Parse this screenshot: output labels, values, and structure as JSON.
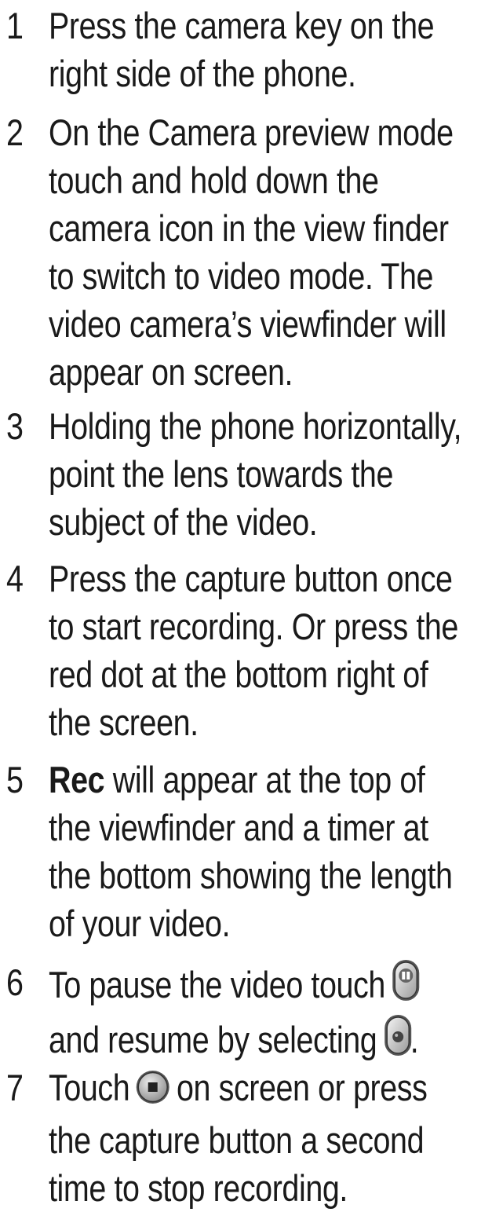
{
  "steps": [
    {
      "number": "1",
      "lines": [
        "Press the camera key on the",
        "right side of the phone."
      ]
    },
    {
      "number": "2",
      "lines": [
        "On the Camera preview mode",
        "touch and hold down the",
        "camera icon in the view finder",
        "to switch to video mode. The",
        "video camera’s viewfinder will",
        "appear on screen."
      ]
    },
    {
      "number": "3",
      "lines": [
        "Holding the phone horizontally,",
        "point the lens towards the",
        "subject of the video."
      ]
    },
    {
      "number": "4",
      "lines": [
        "Press the capture button once",
        "to start recording. Or press the",
        "red dot at the bottom right of",
        "the screen."
      ]
    },
    {
      "number": "5",
      "rec_label": "Rec",
      "line1_rest": " will appear at the top of",
      "lines": [
        "the viewfinder and a timer at",
        "the bottom showing the length",
        "of your video."
      ]
    },
    {
      "number": "6",
      "line1_before": "To pause the video touch ",
      "line2_before": "and resume by selecting ",
      "line2_after": ".",
      "icons": [
        "pause-icon",
        "record-resume-icon"
      ]
    },
    {
      "number": "7",
      "line1_before": "Touch ",
      "line1_after": " on screen or press",
      "lines": [
        "the capture button a second",
        "time to stop recording."
      ],
      "icons": [
        "stop-icon"
      ]
    }
  ]
}
